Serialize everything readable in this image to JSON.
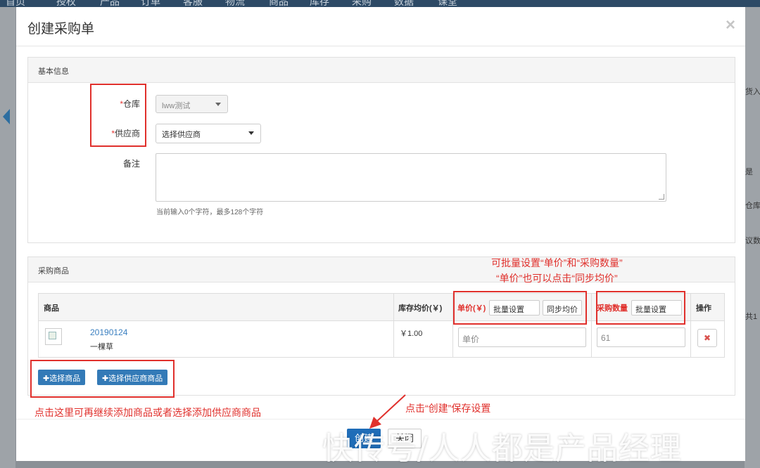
{
  "background_nav": [
    "首页",
    "授权",
    "产品",
    "订单",
    "客服",
    "物流",
    "商品",
    "库存",
    "采购",
    "数据",
    "课堂"
  ],
  "background_right": [
    "货入",
    "是",
    "仓库",
    "议数",
    "共1"
  ],
  "modal": {
    "title": "创建采购单",
    "close_symbol": "×"
  },
  "basic_info": {
    "heading": "基本信息",
    "warehouse": {
      "required_mark": "*",
      "label": "仓库",
      "value": "lww测试"
    },
    "supplier": {
      "required_mark": "*",
      "label": "供应商",
      "value": "选择供应商"
    },
    "remark": {
      "label": "备注",
      "value": "",
      "hint": "当前输入0个字符，最多128个字符"
    }
  },
  "purchase_goods": {
    "heading": "采购商品",
    "columns": {
      "product": "商品",
      "avg_cost": "库存均价(￥)",
      "unit_price": "单价(￥)",
      "batch_set": "批量设置",
      "sync_avg": "同步均价",
      "quantity": "采购数量",
      "batch_set_qty": "批量设置",
      "action": "操作"
    },
    "rows": [
      {
        "code": "20190124",
        "name": "一棵草",
        "avg_cost": "￥1.00",
        "unit_price_placeholder": "单价",
        "quantity": "61",
        "delete_symbol": "✖"
      }
    ],
    "select_goods_label": "✚选择商品",
    "select_supplier_goods_label": "✚选择供应商商品"
  },
  "annotations": {
    "batch_line1": "可批量设置“单价”和“采购数量”",
    "batch_line2": "“单价”也可以点击“同步均价”",
    "add_goods": "点击这里可再继续添加商品或者选择添加供应商商品",
    "create_hint": "点击“创建”保存设置"
  },
  "footer": {
    "create_label": "创建",
    "close_label": "关闭"
  },
  "watermark": "快传号/人人都是产品经理",
  "colors": {
    "annotation_red": "#e0302c",
    "primary_blue": "#337ab7",
    "link_blue": "#3a7fc0"
  }
}
